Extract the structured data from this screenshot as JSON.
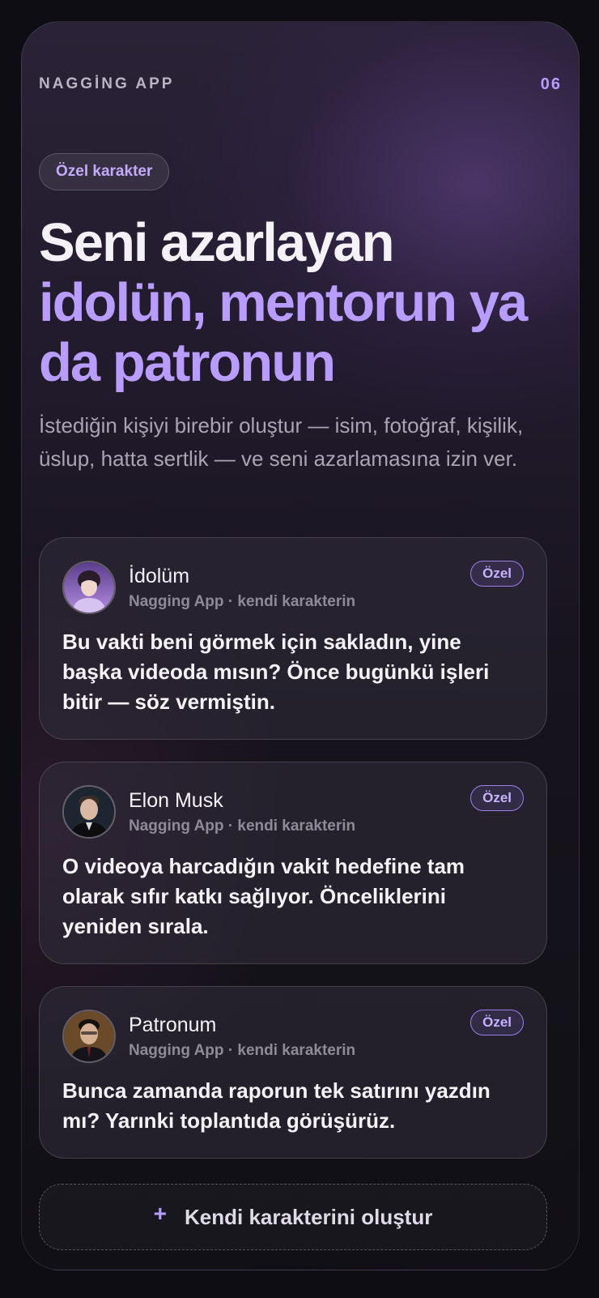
{
  "header": {
    "app_name": "NAGGİNG APP",
    "page_number": "06"
  },
  "tag_pill": "Özel karakter",
  "headline": {
    "line1": "Seni azarlayan",
    "line2": "idolün, mentorun ya",
    "line3": "da patronun"
  },
  "description": "İstediğin kişiyi birebir oluştur — isim, fotoğraf, kişilik, üslup, hatta sertlik — ve seni azarlamasına izin ver.",
  "cards": [
    {
      "name": "İdolüm",
      "subtitle": "Nagging App · kendi karakterin",
      "badge": "Özel",
      "message": "Bu vakti beni görmek için sakladın, yine başka videoda mısın? Önce bugünkü işleri bitir — söz vermiştin."
    },
    {
      "name": "Elon Musk",
      "subtitle": "Nagging App · kendi karakterin",
      "badge": "Özel",
      "message": "O videoya harcadığın vakit hedefine tam olarak sıfır katkı sağlıyor. Önceliklerini yeniden sırala."
    },
    {
      "name": "Patronum",
      "subtitle": "Nagging App · kendi karakterin",
      "badge": "Özel",
      "message": "Bunca zamanda raporun tek satırını yazdın mı? Yarınki toplantıda görüşürüz."
    }
  ],
  "cta": {
    "icon": "plus-icon",
    "label": "Kendi karakterini oluştur"
  },
  "colors": {
    "accent": "#b99cff",
    "background": "#0e0d13"
  }
}
